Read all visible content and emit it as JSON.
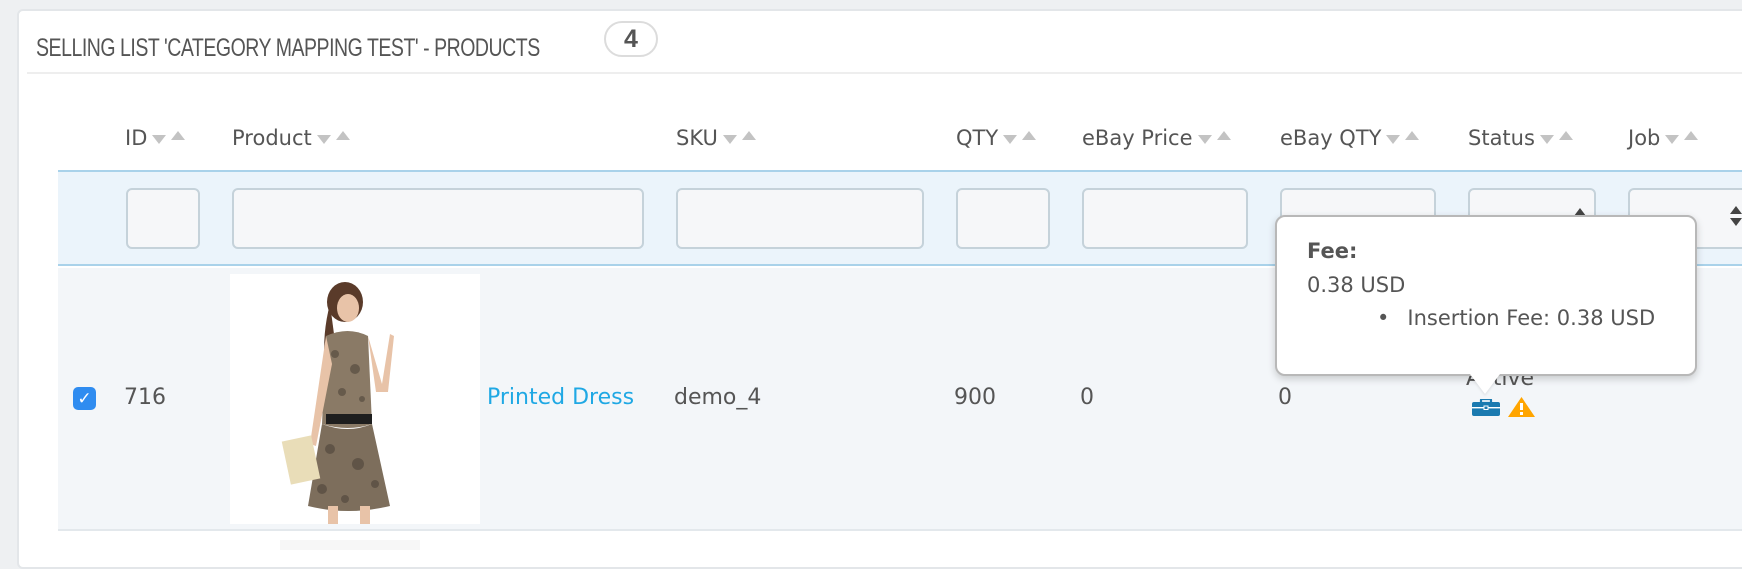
{
  "panel": {
    "title": "SELLING LIST 'CATEGORY MAPPING TEST' - PRODUCTS",
    "count_badge": "4"
  },
  "table": {
    "columns": [
      {
        "key": "id",
        "label": "ID",
        "sortable": true
      },
      {
        "key": "product",
        "label": "Product",
        "sortable": true
      },
      {
        "key": "sku",
        "label": "SKU",
        "sortable": true
      },
      {
        "key": "qty",
        "label": "QTY",
        "sortable": true
      },
      {
        "key": "ebay_price",
        "label": "eBay Price",
        "sortable": true
      },
      {
        "key": "ebay_qty",
        "label": "eBay QTY",
        "sortable": true
      },
      {
        "key": "status",
        "label": "Status",
        "sortable": true
      },
      {
        "key": "job",
        "label": "Job",
        "sortable": true
      }
    ],
    "filters": {
      "id": "",
      "product": "",
      "sku": "",
      "qty": "",
      "ebay_price": "",
      "ebay_qty": "",
      "status": "",
      "job": ""
    },
    "rows": [
      {
        "selected": true,
        "id": "716",
        "product": "Printed Dress",
        "image": "product-thumbnail-printed-dress",
        "sku": "demo_4",
        "qty": "900",
        "ebay_price": "0",
        "ebay_qty": "0",
        "status": "Active",
        "status_icons": [
          "briefcase-icon",
          "warning-icon"
        ]
      }
    ]
  },
  "tooltip": {
    "title": "Fee:",
    "amount": "0.38 USD",
    "items": [
      "Insertion Fee: 0.38 USD"
    ]
  },
  "colors": {
    "link": "#1fa8e4",
    "checkbox": "#2f8cf0",
    "briefcase": "#1a7ab0",
    "warning": "#ffa500",
    "filter_row_bg": "#ebf4fb",
    "filter_row_border": "#a9d2ea"
  }
}
